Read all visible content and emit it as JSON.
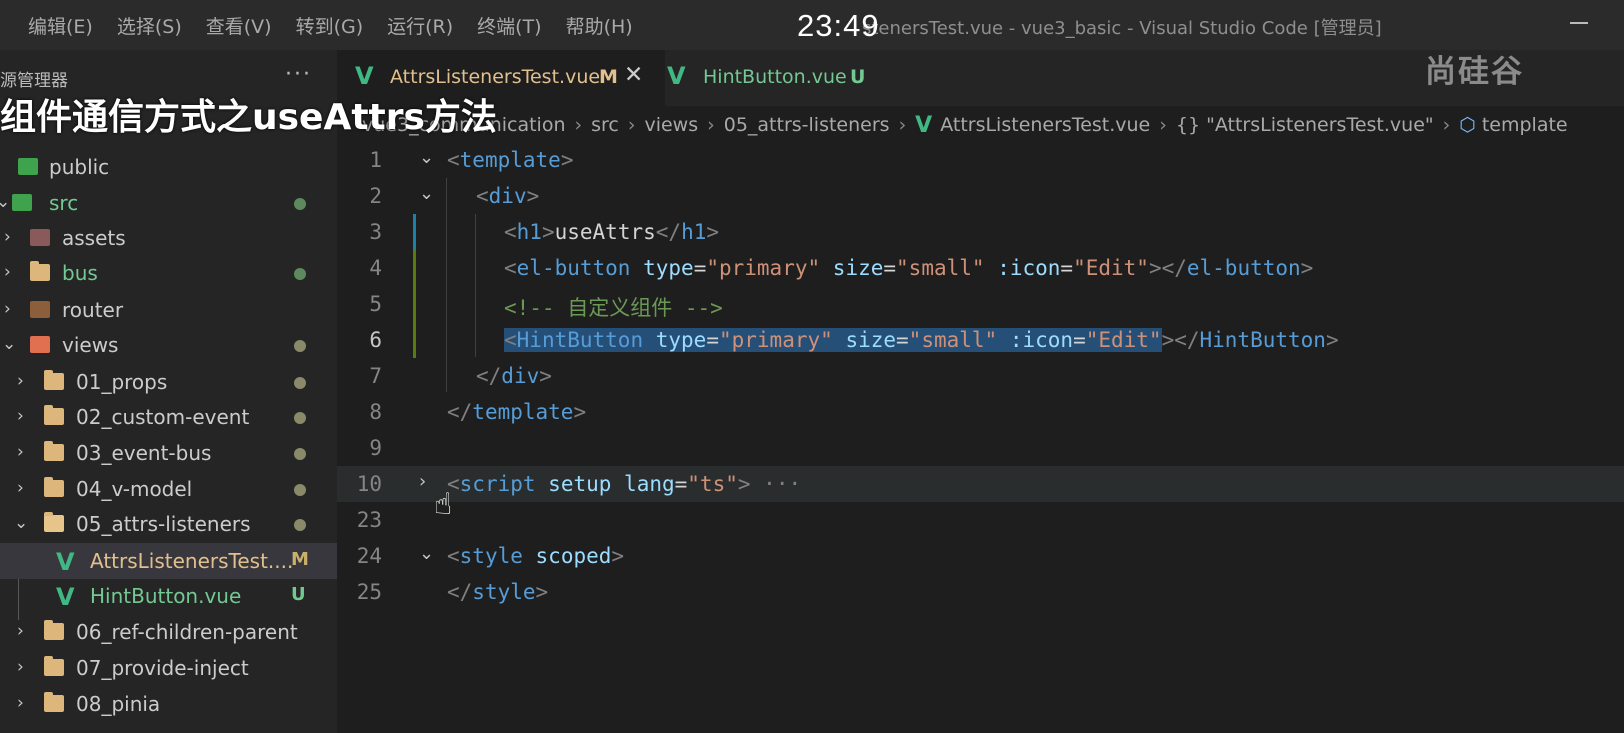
{
  "menu": [
    "编辑(E)",
    "选择(S)",
    "查看(V)",
    "转到(G)",
    "运行(R)",
    "终端(T)",
    "帮助(H)"
  ],
  "window_title": "stenersTest.vue - vue3_basic - Visual Studio Code [管理员]",
  "clock": "23:49",
  "caption": "组件通信方式之useAttrs方法",
  "logo": "尚硅谷",
  "sidebar": {
    "title": "源管理器",
    "more": "···",
    "items": [
      {
        "label": "public"
      },
      {
        "label": "src"
      },
      {
        "label": "assets"
      },
      {
        "label": "bus"
      },
      {
        "label": "router"
      },
      {
        "label": "views"
      },
      {
        "label": "01_props"
      },
      {
        "label": "02_custom-event"
      },
      {
        "label": "03_event-bus"
      },
      {
        "label": "04_v-model"
      },
      {
        "label": "05_attrs-listeners"
      },
      {
        "label": "AttrsListenersTest....",
        "badge": "M"
      },
      {
        "label": "HintButton.vue",
        "badge": "U"
      },
      {
        "label": "06_ref-children-parent"
      },
      {
        "label": "07_provide-inject"
      },
      {
        "label": "08_pinia"
      }
    ]
  },
  "tabs": [
    {
      "label": "AttrsListenersTest.vue",
      "badge": "M",
      "close": "✕"
    },
    {
      "label": "HintButton.vue",
      "badge": "U"
    }
  ],
  "breadcrumb": {
    "items": [
      "vue3_communication",
      "src",
      "views",
      "05_attrs-listeners",
      "AttrsListenersTest.vue",
      "{} \"AttrsListenersTest.vue\"",
      "template"
    ]
  },
  "code": {
    "line_numbers": [
      "1",
      "2",
      "3",
      "4",
      "5",
      "6",
      "7",
      "8",
      "9",
      "10",
      "23",
      "24",
      "25"
    ],
    "l1": {
      "open": "<",
      "tag": "template",
      "close": ">"
    },
    "l2": {
      "open": "<",
      "tag": "div",
      "close": ">"
    },
    "l3": {
      "o1": "<",
      "tag1": "h1",
      "c1": ">",
      "text": "useAttrs",
      "o2": "</",
      "tag2": "h1",
      "c2": ">"
    },
    "l4": {
      "o1": "<",
      "tag1": "el-button",
      "a1": "type",
      "eq": "=",
      "v1": "\"primary\"",
      "a2": "size",
      "v2": "\"small\"",
      "a3": ":icon",
      "v3": "\"Edit\"",
      "c1": "></",
      "tag2": "el-button",
      "c2": ">"
    },
    "l5": {
      "comment": "<!-- 自定义组件 -->"
    },
    "l6": {
      "o1": "<",
      "tag1": "HintButton",
      "a1": "type",
      "v1": "\"primary\"",
      "a2": "size",
      "v2": "\"small\"",
      "a3": ":icon",
      "v3": "\"Edit\"",
      "c1": "></",
      "tag2": "HintButton",
      "c2": ">"
    },
    "l7": {
      "open": "</",
      "tag": "div",
      "close": ">"
    },
    "l8": {
      "open": "</",
      "tag": "template",
      "close": ">"
    },
    "l10": {
      "open": "<",
      "tag": "script",
      "a1": "setup",
      "a2": "lang",
      "v2": "\"ts\"",
      "close": ">",
      "ellipsis": "···"
    },
    "l24": {
      "open": "<",
      "tag": "style",
      "a1": "scoped",
      "close": ">"
    },
    "l25": {
      "open": "</",
      "tag": "style",
      "close": ">"
    }
  }
}
